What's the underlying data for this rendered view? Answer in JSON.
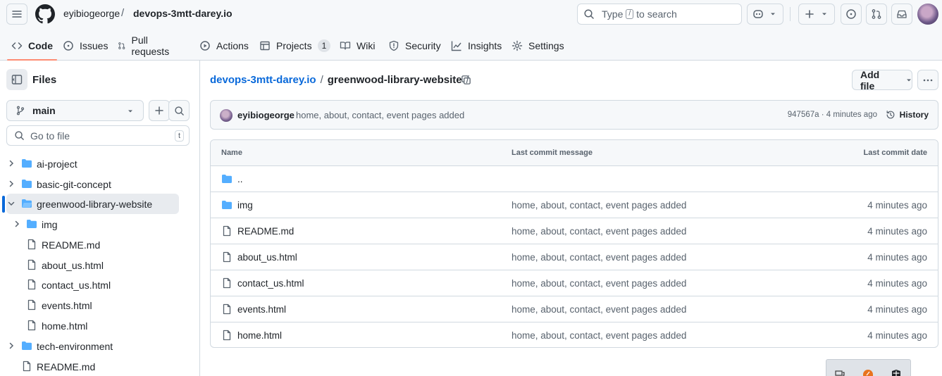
{
  "header": {
    "owner": "eyibiogeorge",
    "separator": "/",
    "repo": "devops-3mtt-darey.io",
    "search": {
      "prefix": "Type",
      "key": "/",
      "suffix": "to search"
    }
  },
  "tabs": [
    {
      "label": "Code"
    },
    {
      "label": "Issues"
    },
    {
      "label": "Pull requests"
    },
    {
      "label": "Actions"
    },
    {
      "label": "Projects",
      "count": "1"
    },
    {
      "label": "Wiki"
    },
    {
      "label": "Security"
    },
    {
      "label": "Insights"
    },
    {
      "label": "Settings"
    }
  ],
  "sidebar": {
    "title": "Files",
    "branch": "main",
    "goto_placeholder": "Go to file",
    "goto_key": "t",
    "tree": [
      {
        "label": "ai-project"
      },
      {
        "label": "basic-git-concept"
      },
      {
        "label": "greenwood-library-website"
      },
      {
        "label": "img"
      },
      {
        "label": "README.md"
      },
      {
        "label": "about_us.html"
      },
      {
        "label": "contact_us.html"
      },
      {
        "label": "events.html"
      },
      {
        "label": "home.html"
      },
      {
        "label": "tech-environment"
      },
      {
        "label": "README.md"
      }
    ]
  },
  "main": {
    "path_repo": "devops-3mtt-darey.io",
    "path_sep": "/",
    "path_folder": "greenwood-library-website",
    "path_trailing": "/",
    "add_file": "Add file",
    "commit": {
      "author": "eyibiogeorge",
      "message": "home, about, contact, event pages added",
      "sha_time": "947567a · 4 minutes ago",
      "history": "History"
    },
    "table": {
      "col_name": "Name",
      "col_msg": "Last commit message",
      "col_date": "Last commit date",
      "rows": [
        {
          "name": "..",
          "msg": "",
          "date": ""
        },
        {
          "name": "img",
          "msg": "home, about, contact, event pages added",
          "date": "4 minutes ago"
        },
        {
          "name": "README.md",
          "msg": "home, about, contact, event pages added",
          "date": "4 minutes ago"
        },
        {
          "name": "about_us.html",
          "msg": "home, about, contact, event pages added",
          "date": "4 minutes ago"
        },
        {
          "name": "contact_us.html",
          "msg": "home, about, contact, event pages added",
          "date": "4 minutes ago"
        },
        {
          "name": "events.html",
          "msg": "home, about, contact, event pages added",
          "date": "4 minutes ago"
        },
        {
          "name": "home.html",
          "msg": "home, about, contact, event pages added",
          "date": "4 minutes ago"
        }
      ]
    }
  },
  "colors": {
    "accent": "#0969da",
    "folder": "#54aeff",
    "tab_underline": "#fd8c73"
  }
}
